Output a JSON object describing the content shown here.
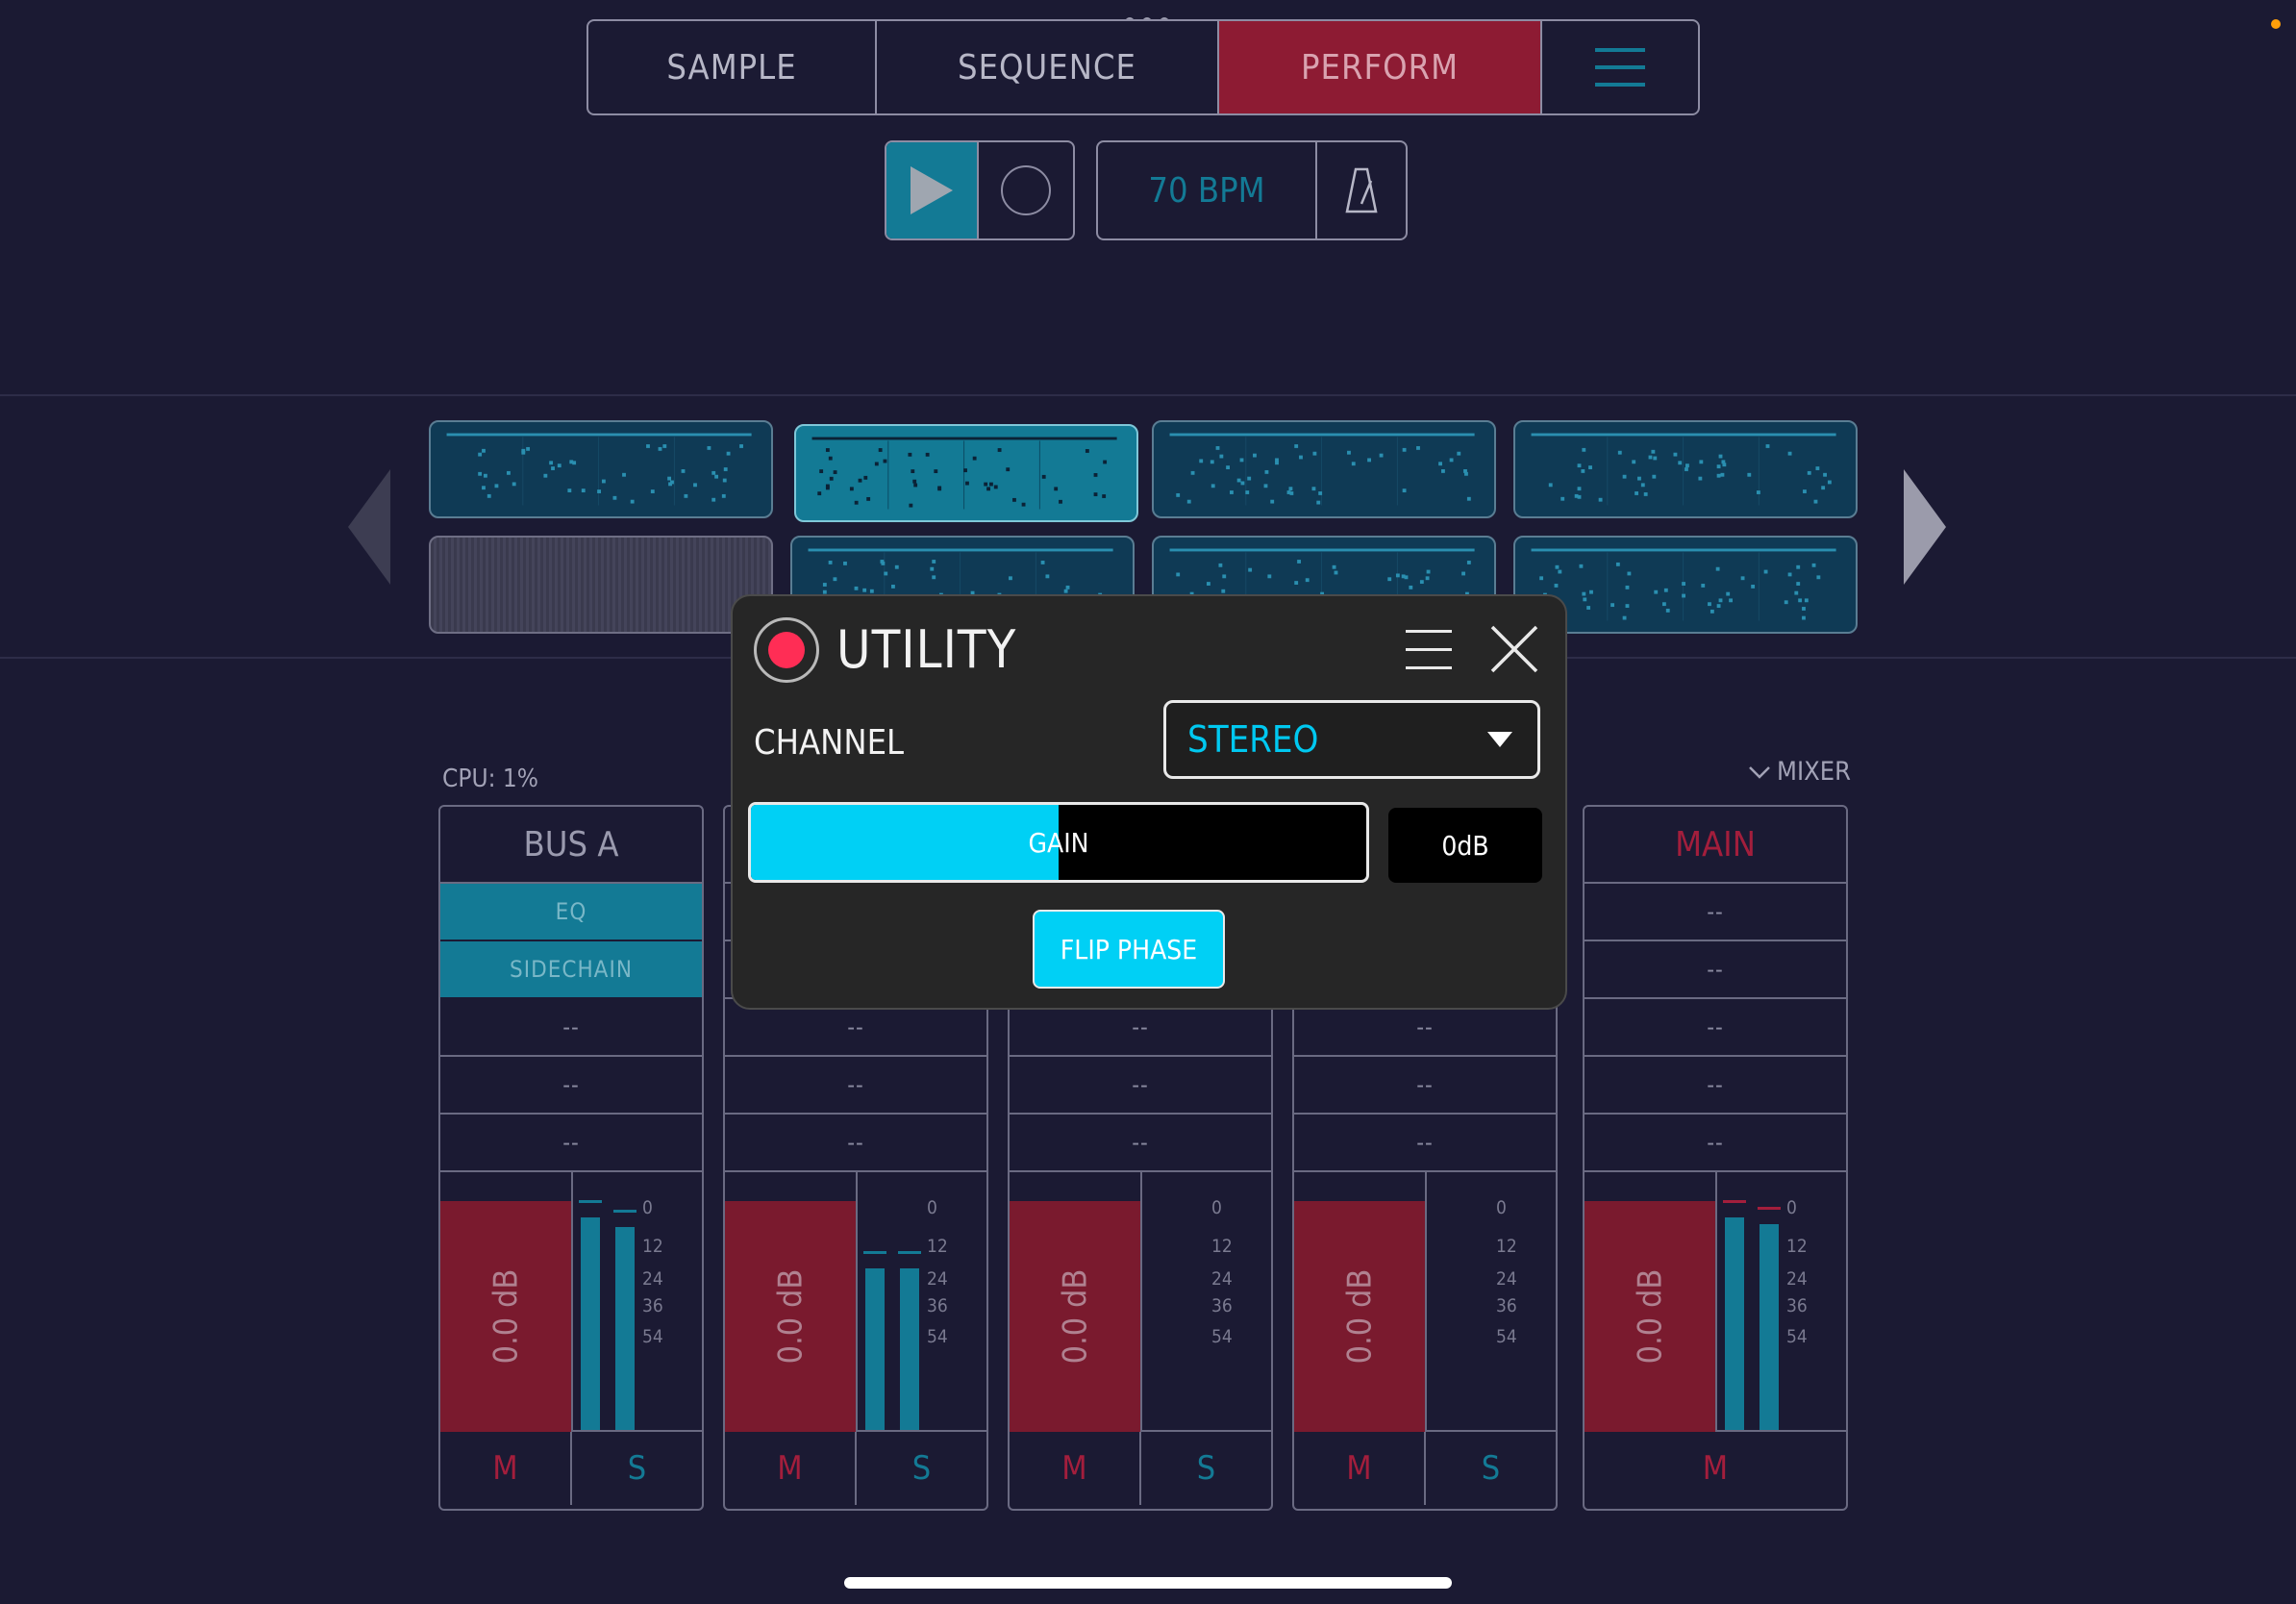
{
  "tabs": [
    {
      "label": "SAMPLE",
      "active": false
    },
    {
      "label": "SEQUENCE",
      "active": false
    },
    {
      "label": "PERFORM",
      "active": true
    }
  ],
  "transport": {
    "tempo": "70 BPM"
  },
  "colors": {
    "accent_teal": "#137a95",
    "accent_red": "#8d1b33",
    "utility_cyan": "#00d0f5",
    "background": "#1b1a33"
  },
  "mixer": {
    "cpu": "CPU: 1%",
    "toggle_label": "MIXER",
    "strips": [
      {
        "name": "BUS A",
        "slots": [
          "EQ",
          "SIDECHAIN",
          "--",
          "--",
          "--"
        ],
        "fader": "0.0 dB",
        "mute": "M",
        "solo": "S",
        "meter_levels": [
          0.92,
          0.88
        ]
      },
      {
        "name": "",
        "slots": [
          "",
          "",
          "--",
          "--",
          "--"
        ],
        "fader": "0.0 dB",
        "mute": "M",
        "solo": "S",
        "meter_levels": [
          0.7,
          0.7
        ]
      },
      {
        "name": "",
        "slots": [
          "",
          "",
          "--",
          "--",
          "--"
        ],
        "fader": "0.0 dB",
        "mute": "M",
        "solo": "S",
        "meter_levels": [
          0,
          0
        ]
      },
      {
        "name": "",
        "slots": [
          "",
          "",
          "--",
          "--",
          "--"
        ],
        "fader": "0.0 dB",
        "mute": "M",
        "solo": "S",
        "meter_levels": [
          0,
          0
        ]
      },
      {
        "name": "MAIN",
        "slots": [
          "--",
          "--",
          "--",
          "--",
          "--"
        ],
        "fader": "0.0 dB",
        "mute": "M",
        "solo": "",
        "meter_levels": [
          0.92,
          0.89
        ]
      }
    ],
    "meter_scale": [
      "0",
      "12",
      "24",
      "36",
      "54"
    ]
  },
  "utility": {
    "title": "UTILITY",
    "channel_label": "CHANNEL",
    "channel_value": "STEREO",
    "gain_label": "GAIN",
    "gain_value": "0dB",
    "gain_fraction": 0.5,
    "flip_phase_label": "FLIP PHASE"
  }
}
